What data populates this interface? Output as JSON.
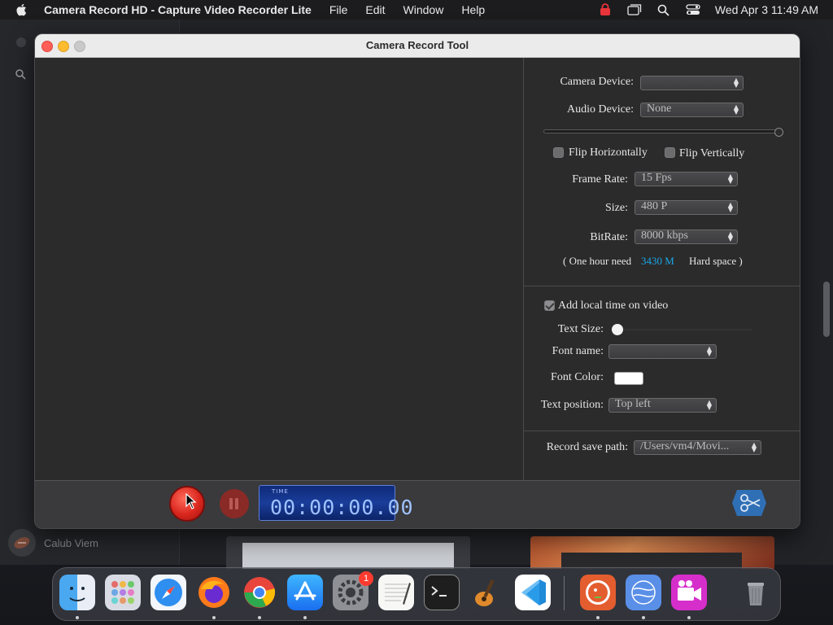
{
  "menubar": {
    "app_name": "Camera Record HD - Capture Video Recorder Lite",
    "menus": [
      "File",
      "Edit",
      "Window",
      "Help"
    ],
    "datetime": "Wed Apr 3  11:49 AM"
  },
  "background_app": {
    "user_name": "Calub Viem"
  },
  "window": {
    "title": "Camera Record Tool"
  },
  "settings": {
    "camera_device_label": "Camera Device:",
    "camera_device_value": "",
    "audio_device_label": "Audio Device:",
    "audio_device_value": "None",
    "audio_level": 0.98,
    "flip_h_label": "Flip Horizontally",
    "flip_v_label": "Flip Vertically",
    "frame_rate_label": "Frame Rate:",
    "frame_rate_value": "15 Fps",
    "size_label": "Size:",
    "size_value": "480 P",
    "bitrate_label": "BitRate:",
    "bitrate_value": "8000 kbps",
    "space_prefix": "( One hour need",
    "space_value": "3430 M",
    "space_suffix": "Hard space )",
    "space_color": "#1aa7e8"
  },
  "overlay": {
    "add_time_label": "Add local time on video",
    "add_time_checked": true,
    "text_size_label": "Text Size:",
    "text_size_level": 0.0,
    "font_name_label": "Font name:",
    "font_name_value": "",
    "font_color_label": "Font Color:",
    "font_color_value": "#ffffff",
    "text_position_label": "Text position:",
    "text_position_value": "Top left"
  },
  "save": {
    "path_label": "Record save path:",
    "path_value": "/Users/vm4/Movi..."
  },
  "controls": {
    "timer_label": "TIME",
    "timer_value": "00:00:00.00"
  },
  "dock": {
    "apps": [
      "Finder",
      "Launchpad",
      "Safari",
      "Firefox",
      "Chrome",
      "App Store",
      "System Settings",
      "TextEdit",
      "Terminal",
      "GarageBand",
      "Visual Studio Code",
      "DuckDuckGo",
      "Network Radar",
      "Camera Record HD",
      "Trash"
    ],
    "settings_badge": "1"
  }
}
